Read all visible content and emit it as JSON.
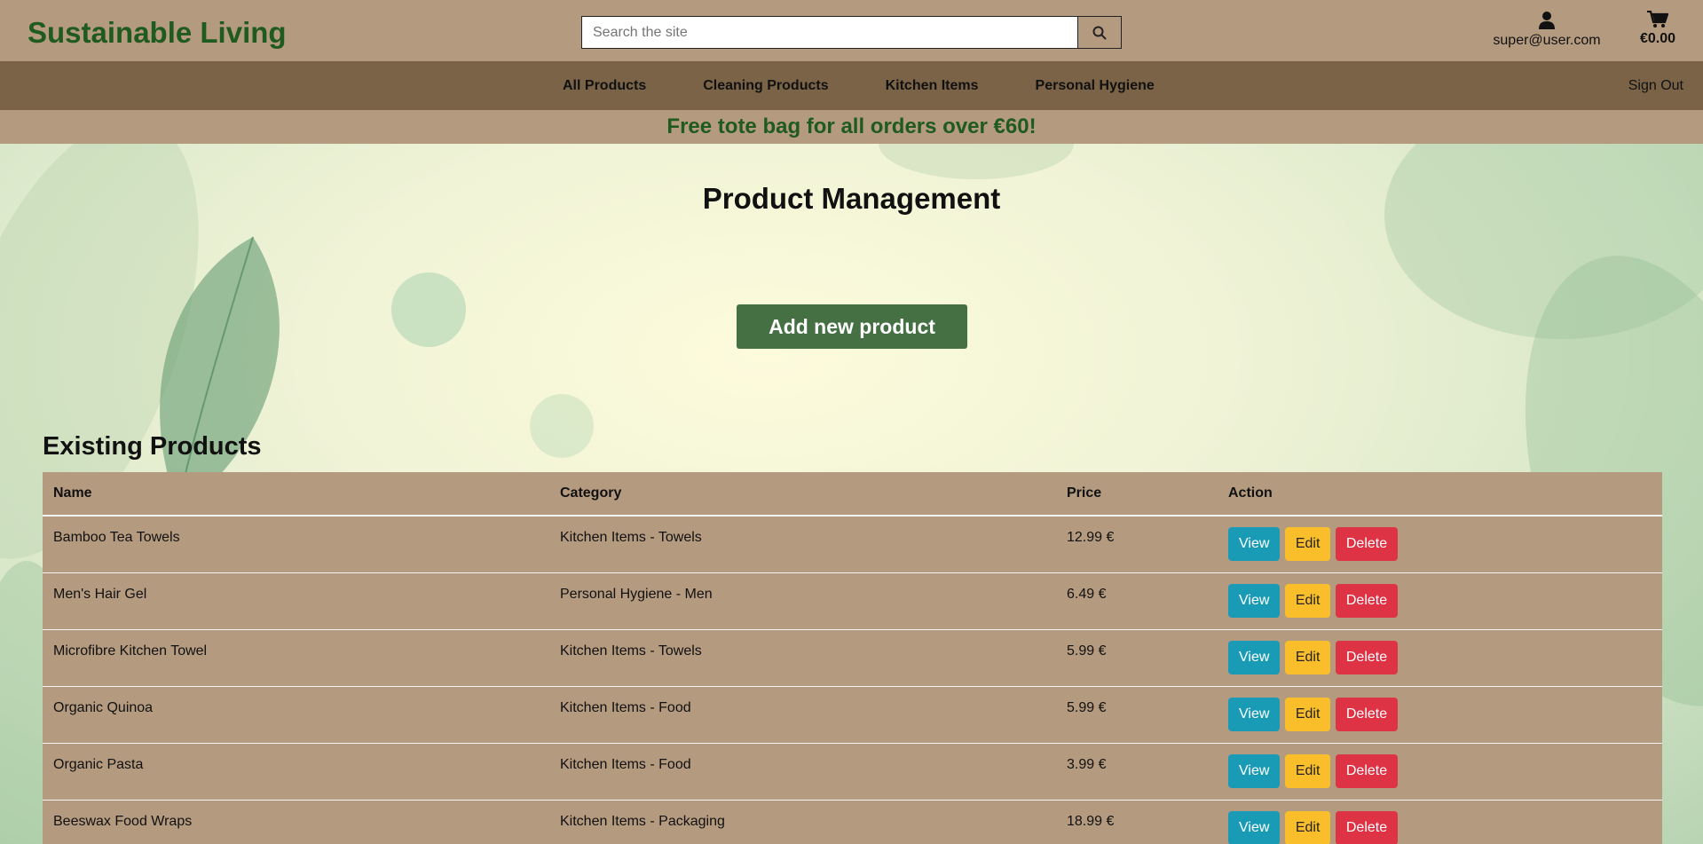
{
  "header": {
    "brand": "Sustainable Living",
    "search_placeholder": "Search the site",
    "account_email": "super@user.com",
    "cart_total": "€0.00"
  },
  "nav": {
    "items": [
      {
        "label": "All Products"
      },
      {
        "label": "Cleaning Products"
      },
      {
        "label": "Kitchen Items"
      },
      {
        "label": "Personal Hygiene"
      }
    ],
    "signout": "Sign Out"
  },
  "promo": "Free tote bag for all orders over €60!",
  "main": {
    "title": "Product Management",
    "add_button": "Add new product",
    "section_title": "Existing Products"
  },
  "table": {
    "headers": [
      "Name",
      "Category",
      "Price",
      "Action"
    ],
    "rows": [
      {
        "name": "Bamboo Tea Towels",
        "category": "Kitchen Items - Towels",
        "price": "12.99 €"
      },
      {
        "name": "Men's Hair Gel",
        "category": "Personal Hygiene - Men",
        "price": "6.49 €"
      },
      {
        "name": "Microfibre Kitchen Towel",
        "category": "Kitchen Items - Towels",
        "price": "5.99 €"
      },
      {
        "name": "Organic Quinoa",
        "category": "Kitchen Items - Food",
        "price": "5.99 €"
      },
      {
        "name": "Organic Pasta",
        "category": "Kitchen Items - Food",
        "price": "3.99 €"
      },
      {
        "name": "Beeswax Food Wraps",
        "category": "Kitchen Items - Packaging",
        "price": "18.99 €"
      }
    ],
    "actions": {
      "view": "View",
      "edit": "Edit",
      "delete": "Delete"
    }
  },
  "colors": {
    "header_bg": "#b49a7f",
    "nav_bg": "#7a6347",
    "brand_green": "#1f5a1f",
    "add_button": "#457043",
    "view": "#1a9bb5",
    "edit": "#fbbe2b",
    "delete": "#dd3344"
  },
  "icons": {
    "search": "search-icon",
    "account": "user-icon",
    "cart": "cart-icon"
  }
}
